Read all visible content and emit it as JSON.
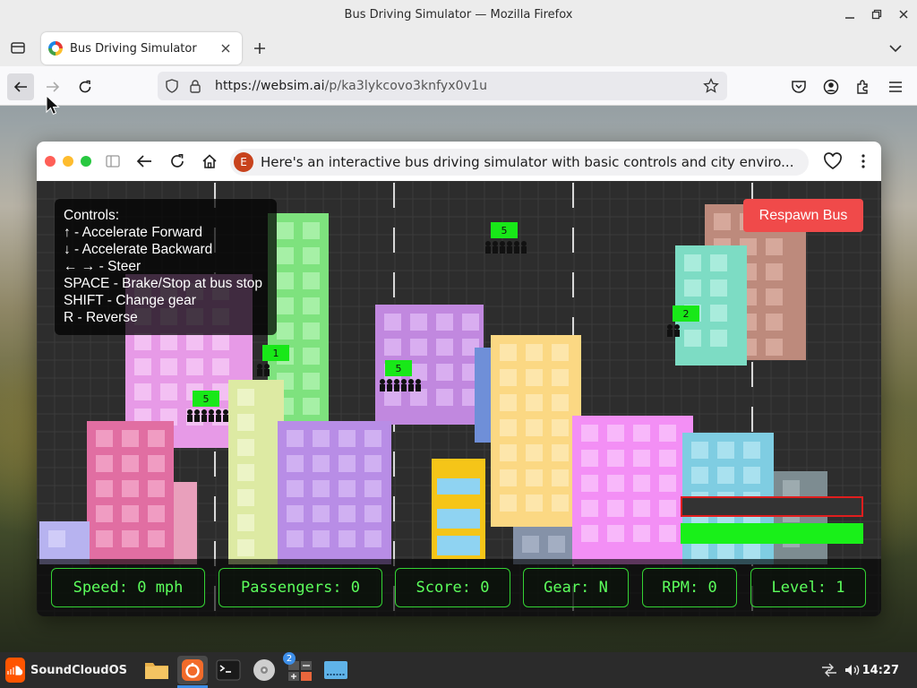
{
  "window": {
    "title": "Bus Driving Simulator — Mozilla Firefox"
  },
  "tab": {
    "title": "Bus Driving Simulator"
  },
  "navbar": {
    "url_host": "https://websim.ai",
    "url_path": "/p/ka3lykcovo3knfyx0v1u"
  },
  "websim": {
    "avatar_letter": "E",
    "prompt": "Here's an interactive bus driving simulator with basic controls and city enviro..."
  },
  "game": {
    "controls": [
      "Controls:",
      "↑ - Accelerate Forward",
      "↓ - Accelerate Backward",
      "← → - Steer",
      "SPACE - Brake/Stop at bus stop",
      "SHIFT - Change gear",
      "R - Reverse"
    ],
    "respawn_label": "Respawn Bus",
    "bus_stops": [
      {
        "label": "5",
        "people": 6
      },
      {
        "label": "2",
        "people": 2
      },
      {
        "label": "1",
        "people": 2
      },
      {
        "label": "5",
        "people": 6
      },
      {
        "label": "5",
        "people": 6
      }
    ],
    "hud": {
      "speed": "Speed: 0 mph",
      "passengers": "Passengers: 0",
      "score": "Score: 0",
      "gear": "Gear: N",
      "rpm": "RPM: 0",
      "level": "Level: 1"
    }
  },
  "taskbar": {
    "start_label": "SoundCloudOS",
    "badge": "2",
    "clock": "14:27"
  }
}
